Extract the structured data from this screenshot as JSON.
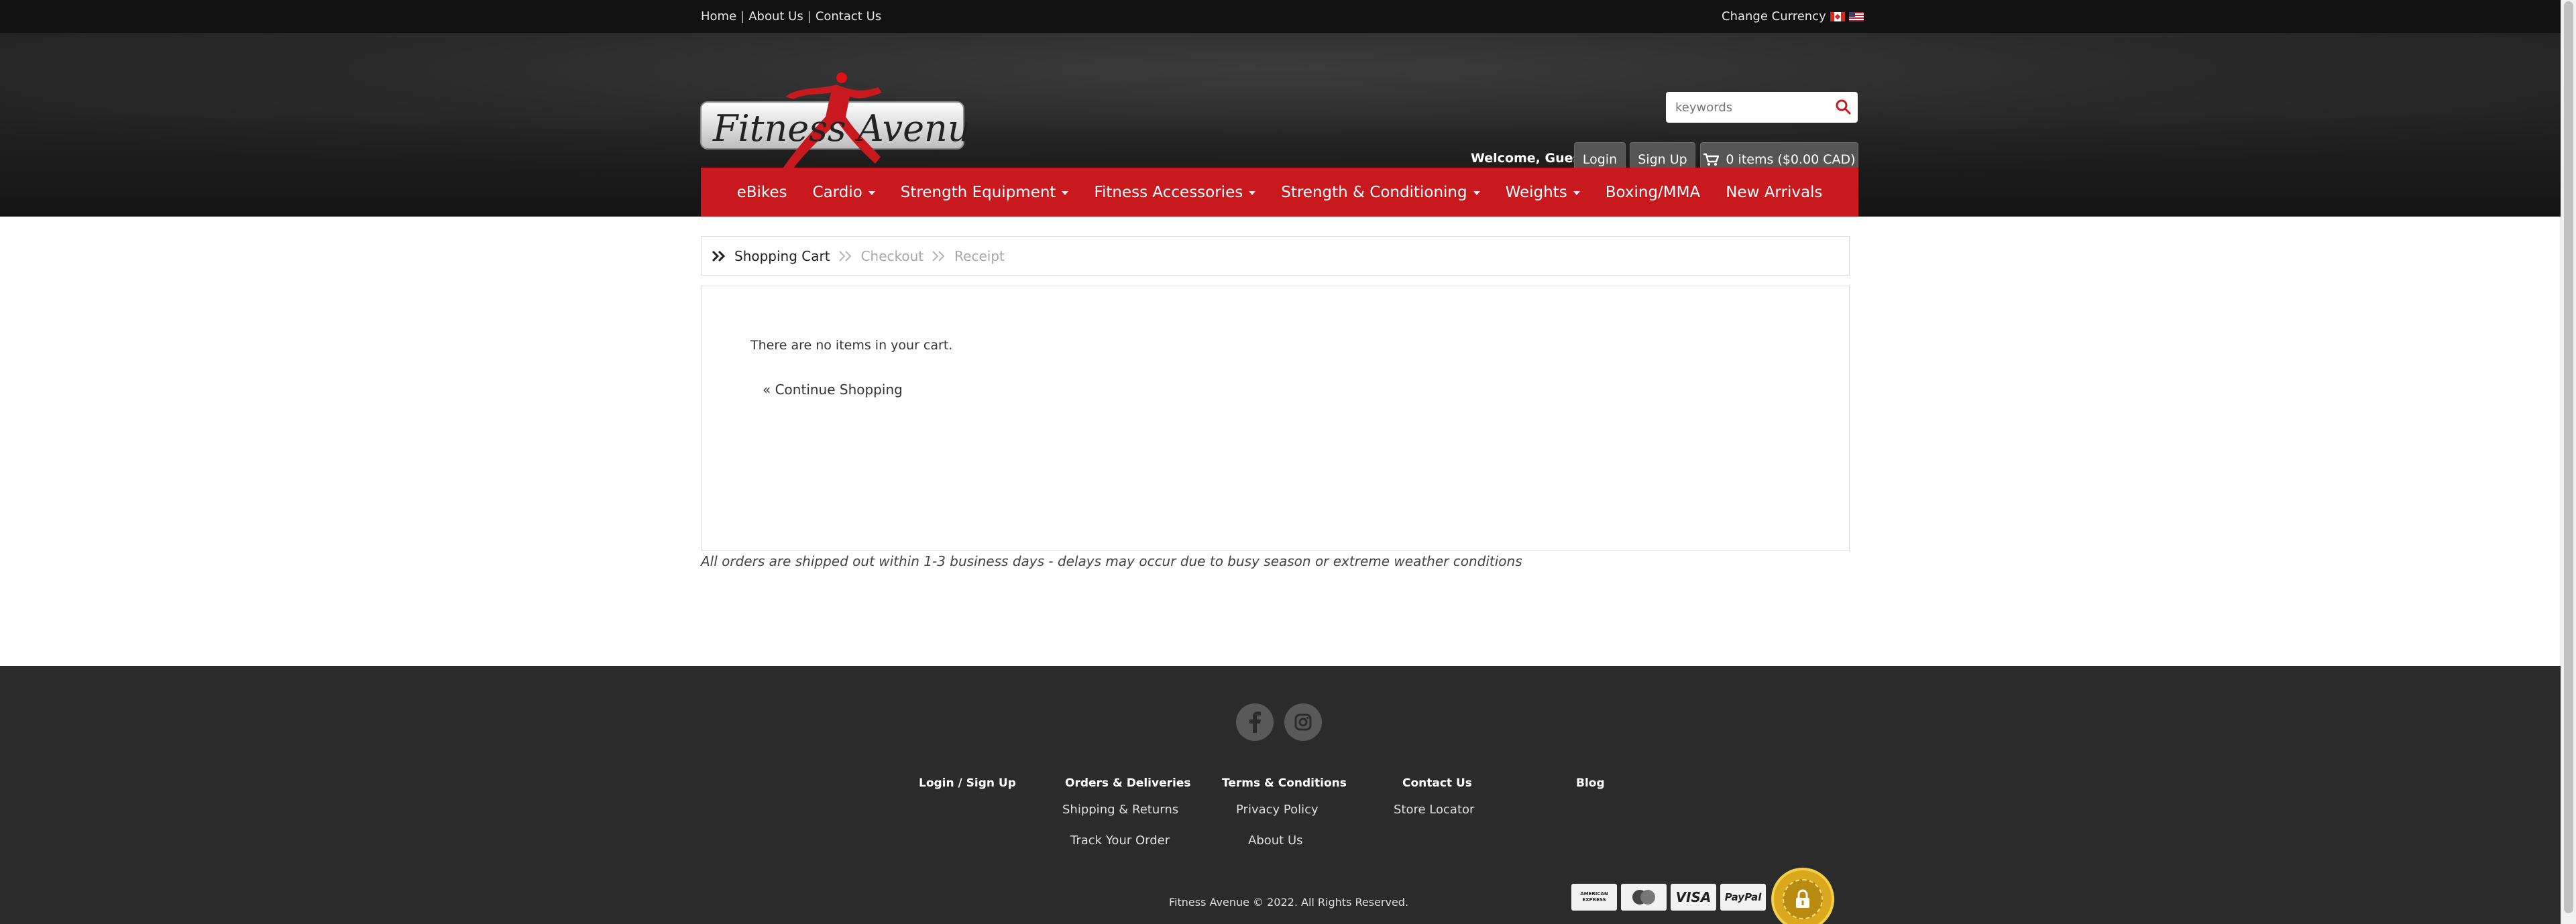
{
  "topbar": {
    "links": [
      {
        "label": "Home"
      },
      {
        "label": "About Us"
      },
      {
        "label": "Contact Us"
      }
    ],
    "separator": "|",
    "currency_label": "Change Currency"
  },
  "logo": {
    "text": "Fitness Avenue"
  },
  "search": {
    "placeholder": "keywords"
  },
  "account": {
    "welcome": "Welcome, Guest",
    "login_label": "Login",
    "signup_label": "Sign Up",
    "cart_label": "0 items ($0.00 CAD)"
  },
  "nav": {
    "items": [
      {
        "label": "eBikes",
        "has_dropdown": false
      },
      {
        "label": "Cardio",
        "has_dropdown": true
      },
      {
        "label": "Strength Equipment",
        "has_dropdown": true
      },
      {
        "label": "Fitness Accessories",
        "has_dropdown": true
      },
      {
        "label": "Strength & Conditioning",
        "has_dropdown": true
      },
      {
        "label": "Weights",
        "has_dropdown": true
      },
      {
        "label": "Boxing/MMA",
        "has_dropdown": false
      },
      {
        "label": "New Arrivals",
        "has_dropdown": false
      }
    ]
  },
  "steps": {
    "items": [
      {
        "label": "Shopping Cart",
        "active": true
      },
      {
        "label": "Checkout",
        "active": false
      },
      {
        "label": "Receipt",
        "active": false
      }
    ]
  },
  "cart": {
    "empty_message": "There are no items in your cart.",
    "continue_label": "« Continue Shopping"
  },
  "shipping_note": "All orders are shipped out within 1-3 business days - delays may occur due to busy season or extreme weather conditions",
  "footer": {
    "social": [
      {
        "icon": "facebook-icon"
      },
      {
        "icon": "instagram-icon"
      }
    ],
    "columns": {
      "login": {
        "title": "Login / Sign Up"
      },
      "orders": {
        "title": "Orders & Deliveries",
        "links": [
          "Shipping & Returns",
          "Track Your Order"
        ]
      },
      "terms": {
        "title": "Terms & Conditions",
        "links": [
          "Privacy Policy",
          "About Us"
        ]
      },
      "contact": {
        "title": "Contact Us",
        "links": [
          "Store Locator"
        ]
      },
      "blog": {
        "title": "Blog"
      }
    },
    "copyright": "Fitness Avenue © 2022. All Rights Reserved.",
    "payments": {
      "amex": "AMERICAN EXPRESS",
      "visa": "VISA",
      "paypal": "PayPal"
    }
  },
  "colors": {
    "brand_red": "#c8191e",
    "topbar": "#111111",
    "footer": "#2b2b2b"
  }
}
